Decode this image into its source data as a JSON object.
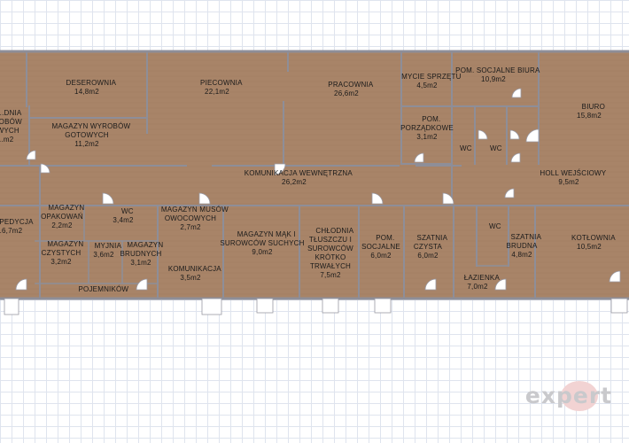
{
  "colors": {
    "floor": "#a88468",
    "wall": "#8e8e98",
    "door": "#ffffff",
    "label": "#1a1a1a",
    "watermark": "#c9c9cc"
  },
  "watermark": {
    "text": "expert"
  },
  "rooms": [
    {
      "id": "deserownia",
      "name": "DESEROWNIA",
      "area": "14,8m2"
    },
    {
      "id": "piecownia",
      "name": "PIECOWNIA",
      "area": "22,1m2"
    },
    {
      "id": "pracownia",
      "name": "PRACOWNIA",
      "area": "26,6m2"
    },
    {
      "id": "mycie-sprzetu",
      "name": "MYCIE SPRZĘTU",
      "area": "4,5m2"
    },
    {
      "id": "pom-socjalne-biura",
      "name": "POM. SOCJALNE BIURA",
      "area": "10,9m2"
    },
    {
      "id": "biuro",
      "name": "BIURO",
      "area": "15,8m2"
    },
    {
      "id": "magazyn-wyrobow-left",
      "name": "...DNIA\nYROBÓW\nOWYCH",
      "area": "...m2"
    },
    {
      "id": "magazyn-wyrobow-gotowych",
      "name": "MAGAZYN WYROBÓW\nGOTOWYCH",
      "area": "11,2m2"
    },
    {
      "id": "pom-porzadkowe",
      "name": "POM.\nPORZĄDKOWE",
      "area": "3,1m2"
    },
    {
      "id": "wc-1",
      "name": "WC",
      "area": ""
    },
    {
      "id": "wc-2",
      "name": "WC",
      "area": ""
    },
    {
      "id": "komunikacja-wewnetrzna",
      "name": "KOMUNIKACJA WEWNĘTRZNA",
      "area": "26,2m2"
    },
    {
      "id": "holl-wejsciowy",
      "name": "HOLL WEJŚCIOWY",
      "area": "9,5m2"
    },
    {
      "id": "ekspedycja",
      "name": "...PEDYCJA",
      "area": "...6,7m2"
    },
    {
      "id": "magazyn-opakowan",
      "name": "MAGAZYN\nOPAKOWAŃ",
      "area": "2,2m2"
    },
    {
      "id": "wc-3",
      "name": "WC",
      "area": "3,4m2"
    },
    {
      "id": "magazyn-musow",
      "name": "MAGAZYN MUSÓW\nOWOCOWYCH",
      "area": "2,7m2"
    },
    {
      "id": "magazyn-mak",
      "name": "MAGAZYN MĄK I\nSUROWCÓW SUCHYCH",
      "area": "9,0m2"
    },
    {
      "id": "chlodnia",
      "name": "CHŁODNIA\nTŁUSZCZU I\nSUROWCÓW\nKRÓTKO\nTRWAŁYCH",
      "area": "7,5m2"
    },
    {
      "id": "pom-socjalne",
      "name": "POM.\nSOCJALNE",
      "area": "6,0m2"
    },
    {
      "id": "szatnia-czysta",
      "name": "SZATNIA\nCZYSTA",
      "area": "6,0m2"
    },
    {
      "id": "wc-4",
      "name": "WC",
      "area": ""
    },
    {
      "id": "szatnia-brudna",
      "name": "SZATNIA\nBRUDNA",
      "area": "4,8m2"
    },
    {
      "id": "kotlownia",
      "name": "KOTŁOWNIA",
      "area": "10,5m2"
    },
    {
      "id": "magazyn-czystych",
      "name": "MAGAZYN\nCZYSTYCH",
      "area": "3,2m2"
    },
    {
      "id": "myjnia",
      "name": "MYJNIA",
      "area": "3,6m2"
    },
    {
      "id": "magazyn-brudnych",
      "name": "MAGAZYN\nBRUDNYCH",
      "area": "3,1m2"
    },
    {
      "id": "komunikacja",
      "name": "KOMUNIKACJA",
      "area": "3,5m2"
    },
    {
      "id": "pojemnikow",
      "name": "POJEMNIKÓW",
      "area": ""
    },
    {
      "id": "lazienka",
      "name": "ŁAZIENKA",
      "area": "7,0m2"
    }
  ]
}
